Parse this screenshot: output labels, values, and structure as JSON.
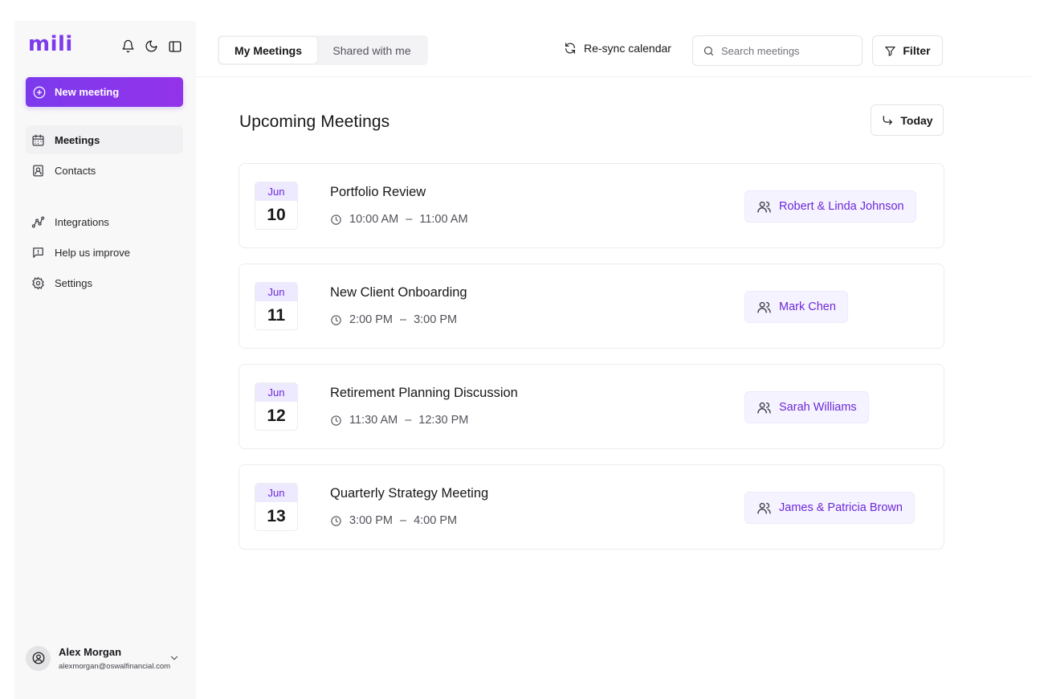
{
  "app": {
    "logo": "mili"
  },
  "sidebar": {
    "new_meeting_label": "New meeting",
    "nav_primary": [
      {
        "label": "Meetings",
        "icon": "calendar-icon",
        "active": true
      },
      {
        "label": "Contacts",
        "icon": "contact-icon",
        "active": false
      }
    ],
    "nav_secondary": [
      {
        "label": "Integrations",
        "icon": "integrations-icon"
      },
      {
        "label": "Help us improve",
        "icon": "feedback-icon"
      },
      {
        "label": "Settings",
        "icon": "gear-icon"
      }
    ],
    "user": {
      "name": "Alex Morgan",
      "email": "alexmorgan@oswalfinancial.com"
    }
  },
  "topbar": {
    "tabs": [
      {
        "label": "My Meetings",
        "active": true
      },
      {
        "label": "Shared with me",
        "active": false
      }
    ],
    "resync_label": "Re-sync calendar",
    "search": {
      "placeholder": "Search meetings",
      "value": ""
    },
    "filter_label": "Filter"
  },
  "main": {
    "title": "Upcoming Meetings",
    "today_label": "Today",
    "meetings": [
      {
        "month": "Jun",
        "day": "10",
        "title": "Portfolio Review",
        "start": "10:00 AM",
        "end": "11:00 AM",
        "attendees": "Robert & Linda Johnson"
      },
      {
        "month": "Jun",
        "day": "11",
        "title": "New Client Onboarding",
        "start": "2:00 PM",
        "end": "3:00 PM",
        "attendees": "Mark Chen"
      },
      {
        "month": "Jun",
        "day": "12",
        "title": "Retirement Planning Discussion",
        "start": "11:30 AM",
        "end": "12:30 PM",
        "attendees": "Sarah Williams"
      },
      {
        "month": "Jun",
        "day": "13",
        "title": "Quarterly Strategy Meeting",
        "start": "3:00 PM",
        "end": "4:00 PM",
        "attendees": "James & Patricia Brown"
      }
    ],
    "time_separator": "–"
  },
  "colors": {
    "accent": "#7c3aed",
    "accent_light": "#ede9fe",
    "sidebar_bg": "#f8f8f9"
  }
}
